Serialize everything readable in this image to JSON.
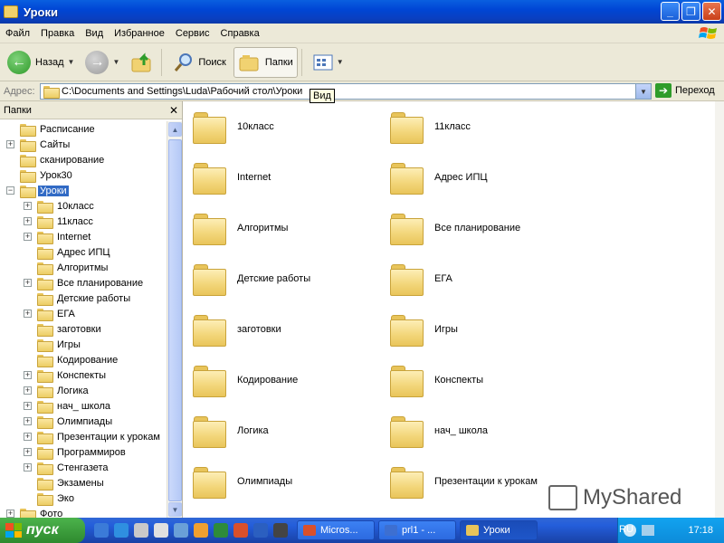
{
  "window": {
    "title": "Уроки"
  },
  "menu": [
    "Файл",
    "Правка",
    "Вид",
    "Избранное",
    "Сервис",
    "Справка"
  ],
  "toolbar": {
    "back": "Назад",
    "search": "Поиск",
    "folders": "Папки",
    "tooltip": "Вид"
  },
  "address": {
    "label": "Адрес:",
    "path": "C:\\Documents and Settings\\Luda\\Рабочий стол\\Уроки",
    "go": "Переход"
  },
  "folders_pane": {
    "title": "Папки",
    "items": [
      {
        "label": "Расписание",
        "level": 1,
        "expander": ""
      },
      {
        "label": "Сайты",
        "level": 1,
        "expander": "+"
      },
      {
        "label": "сканирование",
        "level": 1,
        "expander": ""
      },
      {
        "label": "Урок30",
        "level": 1,
        "expander": ""
      },
      {
        "label": "Уроки",
        "level": 1,
        "expander": "−",
        "selected": true
      },
      {
        "label": "10класс",
        "level": 2,
        "expander": "+"
      },
      {
        "label": "11класс",
        "level": 2,
        "expander": "+"
      },
      {
        "label": "Internet",
        "level": 2,
        "expander": "+"
      },
      {
        "label": "Адрес ИПЦ",
        "level": 2,
        "expander": ""
      },
      {
        "label": "Алгоритмы",
        "level": 2,
        "expander": ""
      },
      {
        "label": "Все планирование",
        "level": 2,
        "expander": "+"
      },
      {
        "label": "Детские работы",
        "level": 2,
        "expander": ""
      },
      {
        "label": "ЕГА",
        "level": 2,
        "expander": "+"
      },
      {
        "label": "заготовки",
        "level": 2,
        "expander": ""
      },
      {
        "label": "Игры",
        "level": 2,
        "expander": ""
      },
      {
        "label": "Кодирование",
        "level": 2,
        "expander": ""
      },
      {
        "label": "Конспекты",
        "level": 2,
        "expander": "+"
      },
      {
        "label": "Логика",
        "level": 2,
        "expander": "+"
      },
      {
        "label": "нач_ школа",
        "level": 2,
        "expander": "+"
      },
      {
        "label": "Олимпиады",
        "level": 2,
        "expander": "+"
      },
      {
        "label": "Презентации к урокам",
        "level": 2,
        "expander": "+"
      },
      {
        "label": "Программиров",
        "level": 2,
        "expander": "+"
      },
      {
        "label": "Стенгазета",
        "level": 2,
        "expander": "+"
      },
      {
        "label": "Экзамены",
        "level": 2,
        "expander": ""
      },
      {
        "label": "Эко",
        "level": 2,
        "expander": ""
      },
      {
        "label": "Фото",
        "level": 1,
        "expander": "+"
      }
    ]
  },
  "content": {
    "items": [
      "10класс",
      "11класс",
      "Internet",
      "Адрес ИПЦ",
      "Алгоритмы",
      "Все планирование",
      "Детские работы",
      "ЕГА",
      "заготовки",
      "Игры",
      "Кодирование",
      "Конспекты",
      "Логика",
      "нач_ школа",
      "Олимпиады",
      "Презентации к урокам"
    ]
  },
  "watermark": "MyShared",
  "taskbar": {
    "start": "пуск",
    "tasks": [
      {
        "label": "Micros...",
        "color": "#d9502b"
      },
      {
        "label": "prl1 - ...",
        "color": "#3d6fd1"
      },
      {
        "label": "Уроки",
        "color": "#e8c45a",
        "active": true
      }
    ],
    "lang": "RU",
    "clock": "17:18"
  }
}
